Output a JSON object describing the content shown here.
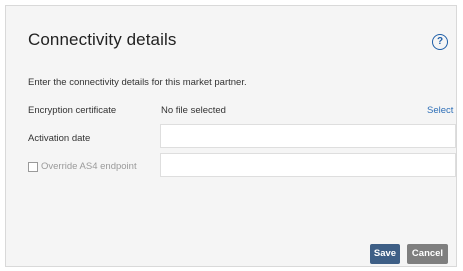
{
  "dialog": {
    "title": "Connectivity details",
    "help_icon": "?",
    "intro": "Enter the connectivity details for this market partner."
  },
  "form": {
    "encryption_label": "Encryption certificate",
    "encryption_value": "No file selected",
    "select_link": "Select",
    "activation_label": "Activation date",
    "activation_value": "",
    "override_label": "Override AS4 endpoint",
    "override_checked": false,
    "endpoint_value": ""
  },
  "actions": {
    "save_label": "Save",
    "cancel_label": "Cancel"
  },
  "colors": {
    "primary_button": "#3e5f86",
    "secondary_button": "#7f7f7f",
    "link": "#2e6fb7",
    "help_icon": "#1f5fa8"
  }
}
